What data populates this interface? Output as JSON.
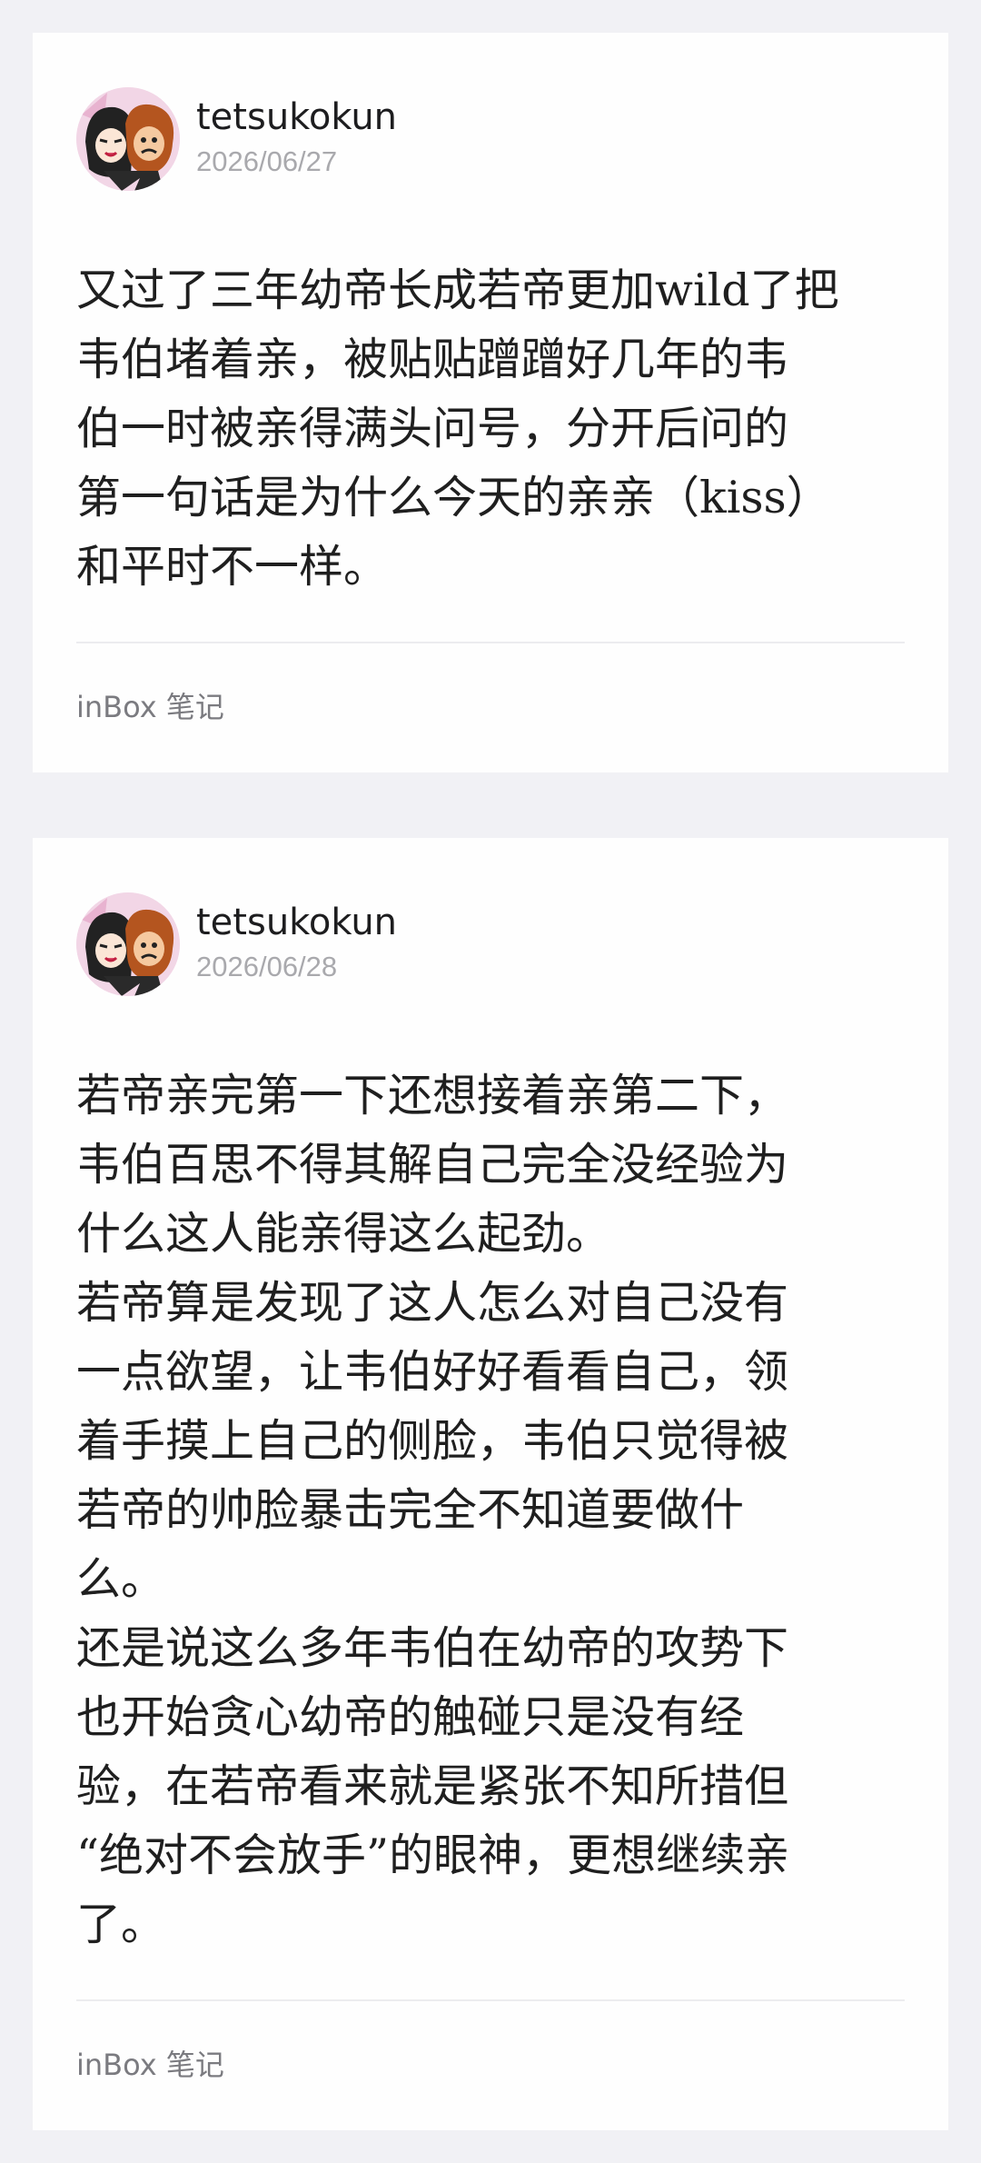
{
  "posts": [
    {
      "username": "tetsukokun",
      "date": "2026/06/27",
      "body": "又过了三年幼帝长成若帝更加wild了把\n韦伯堵着亲，被贴贴蹭蹭好几年的韦\n伯一时被亲得满头问号，分开后问的\n第一句话是为什么今天的亲亲（kiss）\n和平时不一样。",
      "footer": "inBox 笔记"
    },
    {
      "username": "tetsukokun",
      "date": "2026/06/28",
      "body": "若帝亲完第一下还想接着亲第二下，\n韦伯百思不得其解自己完全没经验为\n什么这人能亲得这么起劲。\n若帝算是发现了这人怎么对自己没有\n一点欲望，让韦伯好好看看自己，领\n着手摸上自己的侧脸，韦伯只觉得被\n若帝的帅脸暴击完全不知道要做什\n么。\n还是说这么多年韦伯在幼帝的攻势下\n也开始贪心幼帝的触碰只是没有经\n验，在若帝看来就是紧张不知所措但\n“绝对不会放手”的眼神，更想继续亲\n了。",
      "footer": "inBox 笔记"
    }
  ],
  "avatar_icon": "user-avatar-illustration",
  "colors": {
    "background": "#f1f1f5",
    "card": "#fefefe",
    "username": "#1d1d1f",
    "date": "#a9a9ad",
    "body": "#1f1f1f",
    "footer": "#7b7b80"
  }
}
